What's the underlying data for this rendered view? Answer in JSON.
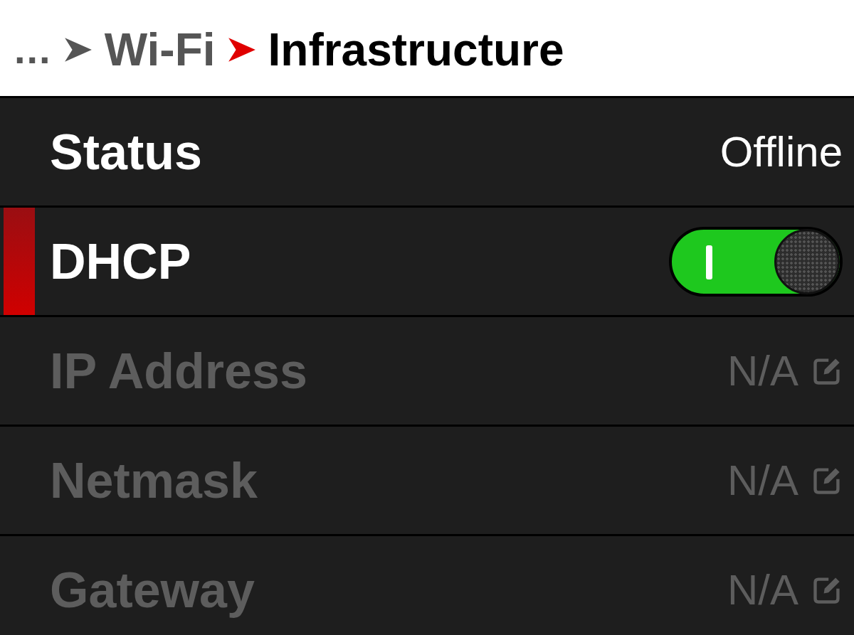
{
  "breadcrumb": [
    {
      "label": "...",
      "current": false
    },
    {
      "label": "Wi-Fi",
      "current": false
    },
    {
      "label": "Infrastructure",
      "current": true
    }
  ],
  "rows": [
    {
      "kind": "text",
      "label": "Status",
      "value": "Offline",
      "selected": false,
      "disabled": false
    },
    {
      "kind": "toggle",
      "label": "DHCP",
      "on": true,
      "selected": true,
      "disabled": false
    },
    {
      "kind": "edit",
      "label": "IP Address",
      "value": "N/A",
      "selected": false,
      "disabled": true
    },
    {
      "kind": "edit",
      "label": "Netmask",
      "value": "N/A",
      "selected": false,
      "disabled": true
    },
    {
      "kind": "edit",
      "label": "Gateway",
      "value": "N/A",
      "selected": false,
      "disabled": true
    }
  ]
}
